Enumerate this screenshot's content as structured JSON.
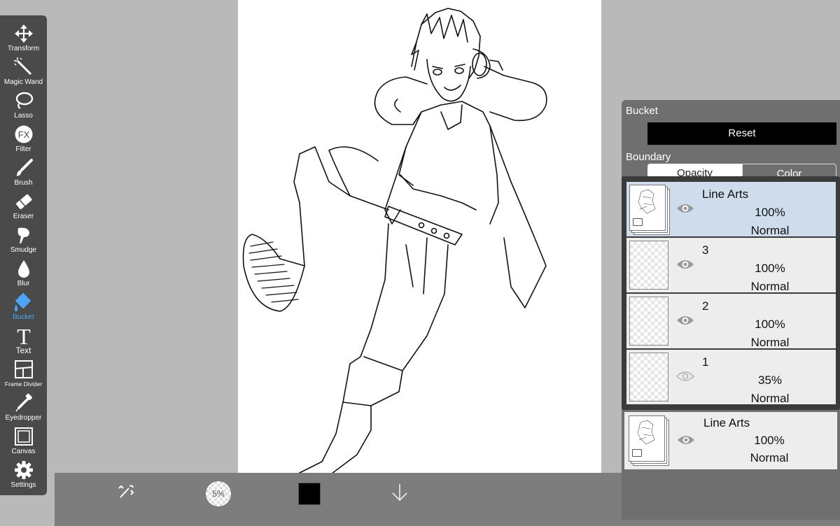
{
  "toolbar": {
    "tools": [
      {
        "label": "Transform",
        "icon": "transform-icon"
      },
      {
        "label": "Magic Wand",
        "icon": "magic-wand-icon"
      },
      {
        "label": "Lasso",
        "icon": "lasso-icon"
      },
      {
        "label": "Filter",
        "icon": "fx-icon"
      },
      {
        "label": "Brush",
        "icon": "brush-icon"
      },
      {
        "label": "Eraser",
        "icon": "eraser-icon"
      },
      {
        "label": "Smudge",
        "icon": "smudge-icon"
      },
      {
        "label": "Blur",
        "icon": "blur-icon"
      },
      {
        "label": "Bucket",
        "icon": "bucket-icon",
        "active": true
      },
      {
        "label": "Text",
        "icon": "text-icon"
      },
      {
        "label": "Frame Divider",
        "icon": "frame-divider-icon"
      },
      {
        "label": "Eyedropper",
        "icon": "eyedropper-icon"
      },
      {
        "label": "Canvas",
        "icon": "canvas-icon"
      },
      {
        "label": "Settings",
        "icon": "settings-icon"
      }
    ],
    "active_color": "#4da3f5"
  },
  "bucket_panel": {
    "title": "Bucket",
    "reset_label": "Reset",
    "boundary_label": "Boundary",
    "segments": [
      "Opacity",
      "Color"
    ]
  },
  "layers": [
    {
      "name": "Line Arts",
      "opacity": "100%",
      "blend": "Normal",
      "visible": true,
      "selected": true,
      "folder": true
    },
    {
      "name": "3",
      "opacity": "100%",
      "blend": "Normal",
      "visible": true,
      "selected": false,
      "folder": false
    },
    {
      "name": "2",
      "opacity": "100%",
      "blend": "Normal",
      "visible": true,
      "selected": false,
      "folder": false
    },
    {
      "name": "1",
      "opacity": "35%",
      "blend": "Normal",
      "visible": true,
      "selected": false,
      "folder": false
    }
  ],
  "ghost_layer": {
    "name": "Line Arts",
    "opacity": "100%",
    "blend": "Normal"
  },
  "bottom_bar": {
    "brush_size": "5%",
    "primary_color": "#000000",
    "layer_count": "3"
  }
}
